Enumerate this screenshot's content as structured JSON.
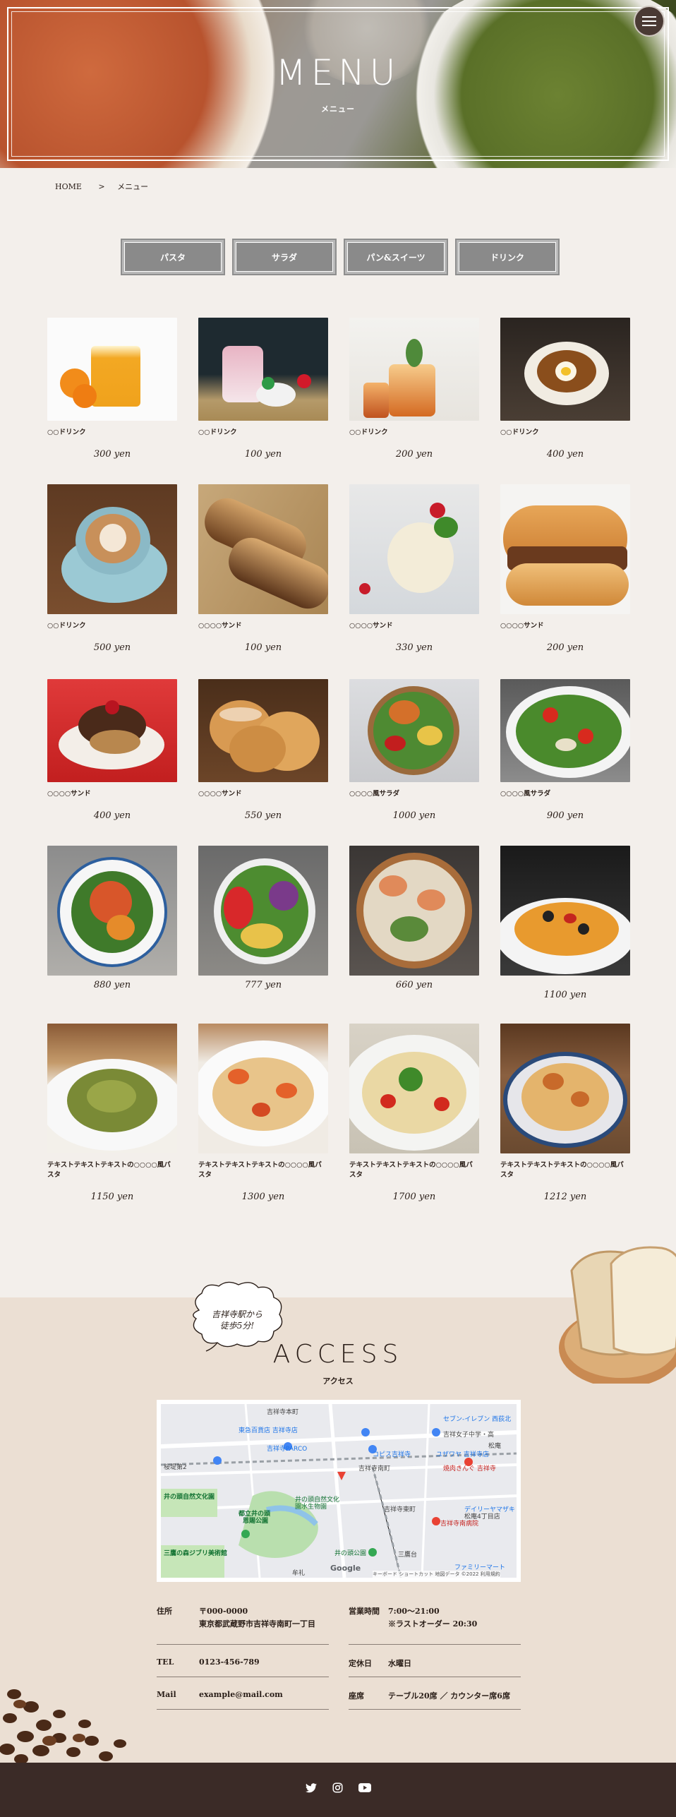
{
  "hero": {
    "title": "MENU",
    "subtitle": "メニュー"
  },
  "breadcrumb": {
    "home": "HOME",
    "sep": ">",
    "current": "メニュー"
  },
  "tabs": [
    "パスタ",
    "サラダ",
    "パン&スイーツ",
    "ドリンク"
  ],
  "menu_items": [
    {
      "name": "○○ドリンク",
      "price": "300 yen"
    },
    {
      "name": "○○ドリンク",
      "price": "100 yen"
    },
    {
      "name": "○○ドリンク",
      "price": "200 yen"
    },
    {
      "name": "○○ドリンク",
      "price": "400 yen"
    },
    {
      "name": "○○ドリンク",
      "price": "500 yen"
    },
    {
      "name": "○○○○サンド",
      "price": "100 yen"
    },
    {
      "name": "○○○○サンド",
      "price": "330 yen"
    },
    {
      "name": "○○○○サンド",
      "price": "200 yen"
    },
    {
      "name": "○○○○サンド",
      "price": "400 yen"
    },
    {
      "name": "○○○○サンド",
      "price": "550 yen"
    },
    {
      "name": "○○○○風サラダ",
      "price": "1000 yen"
    },
    {
      "name": "○○○○風サラダ",
      "price": "900 yen"
    },
    {
      "name": "",
      "price": "880 yen"
    },
    {
      "name": "",
      "price": "777 yen"
    },
    {
      "name": "",
      "price": "660 yen"
    },
    {
      "name": "",
      "price": "1100 yen"
    },
    {
      "name": "テキストテキストテキストの○○○○風パスタ",
      "price": "1150 yen"
    },
    {
      "name": "テキストテキストテキストの○○○○風パスタ",
      "price": "1300 yen"
    },
    {
      "name": "テキストテキストテキストの○○○○風パスタ",
      "price": "1700 yen"
    },
    {
      "name": "テキストテキストテキストの○○○○風パスタ",
      "price": "1212 yen"
    }
  ],
  "access": {
    "bubble_line1": "吉祥寺駅から",
    "bubble_line2": "徒歩5分!",
    "title": "ACCESS",
    "subtitle": "アクセス",
    "map_labels": {
      "l1": "吉祥寺本町",
      "l2": "セブン-イレブン 西荻北",
      "l3": "東急百貨店 吉祥寺店",
      "l4": "吉祥寺PARCO",
      "l5": "吉祥女子中学・高",
      "l6": "松庵",
      "l7": "コピス吉祥寺",
      "l8": "ユザワヤ 吉祥寺店",
      "l9": "吉祥寺南町",
      "l10": "焼肉きんぐ 吉祥寺",
      "l11": "井の頭自然文化園",
      "l12": "井の頭自然文化",
      "l13": "園水生物園",
      "l14": "都立井の頭",
      "l15": "恩賜公園",
      "l16": "吉祥寺南病院",
      "l17": "デイリーヤマザキ",
      "l18": "松庵4丁目店",
      "l19": "吉祥寺東町",
      "l20": "井の頭公園",
      "l21": "三鷹の森ジブリ美術館",
      "l22": "三鷹台",
      "l23": "牟礼",
      "l24": "Google",
      "l25": "キーボード ショートカット  地図データ ©2022  利用規約",
      "l26": "桜堤第2",
      "l27": "ファミリーマート"
    },
    "info": {
      "addr_k": "住所",
      "addr_v1": "〒000-0000",
      "addr_v2": "東京都武蔵野市吉祥寺南町一丁目",
      "tel_k": "TEL",
      "tel_v": "0123-456-789",
      "mail_k": "Mail",
      "mail_v": "example@mail.com",
      "hours_k": "営業時間",
      "hours_v1": "7:00～21:00",
      "hours_v2": "※ラストオーダー 20:30",
      "closed_k": "定休日",
      "closed_v": "水曜日",
      "seats_k": "座席",
      "seats_v": "テーブル20席 ／ カウンター席6席"
    }
  },
  "footer": {
    "icons": [
      "twitter-icon",
      "instagram-icon",
      "youtube-icon"
    ]
  }
}
